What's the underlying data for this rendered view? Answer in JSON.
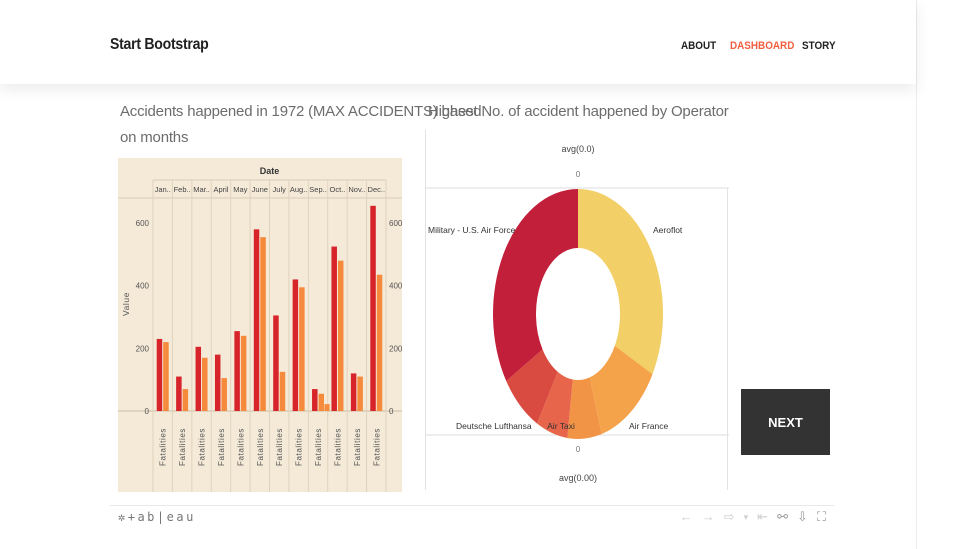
{
  "nav": {
    "brand": "Start Bootstrap",
    "links": [
      {
        "label": "ABOUT",
        "active": false
      },
      {
        "label": "DASHBOARD",
        "active": true
      },
      {
        "label": "STORY",
        "active": false
      }
    ],
    "accent": "#f05f40"
  },
  "bar_title_line1": "Accidents happened in 1972 (MAX ACCIDENTS) based",
  "bar_title_line2": "on months",
  "donut_title": "Highest No. of accident happened by Operator",
  "next_label": "NEXT",
  "tableau_logo": "+ab|eau",
  "tableau_tools": [
    "undo-icon",
    "redo-icon",
    "revert-icon",
    "dropdown-icon",
    "reset-icon",
    "share-icon",
    "download-icon",
    "fullscreen-icon"
  ],
  "chart_data": [
    {
      "type": "bar",
      "title": "",
      "header": "Date",
      "categories": [
        "Jan..",
        "Feb..",
        "Mar..",
        "April",
        "May",
        "June",
        "July",
        "Aug..",
        "Sep..",
        "Oct..",
        "Nov..",
        "Dec.."
      ],
      "category_sublabel": "Fatalities",
      "ylabel": "Value",
      "ylim": [
        0,
        680
      ],
      "yticks": [
        0,
        200,
        400,
        600
      ],
      "series": [
        {
          "color": "#d7242a",
          "values": [
            230,
            110,
            205,
            180,
            255,
            580,
            305,
            420,
            70,
            525,
            120,
            655
          ]
        },
        {
          "color": "#f58a3c",
          "values": [
            220,
            70,
            170,
            105,
            240,
            555,
            125,
            395,
            55,
            480,
            110,
            435
          ]
        }
      ],
      "extra_bar": {
        "category_index": 8,
        "color": "#f58a3c",
        "value": 22
      },
      "background": "#f5ead8"
    },
    {
      "type": "pie",
      "style": "donut",
      "top_label": "avg(0.0)",
      "top_value": "0",
      "bottom_value": "0",
      "bottom_label": "avg(0.00)",
      "slices": [
        {
          "label": "Aeroflot",
          "value": 33,
          "color": "#f2cf67"
        },
        {
          "label": "",
          "value": 12.5,
          "color": "#f5a34b"
        },
        {
          "label": "Air France",
          "value": 6.5,
          "color": "#f19446"
        },
        {
          "label": "Air Taxi",
          "value": 6,
          "color": "#e7654a"
        },
        {
          "label": "Deutsche Lufthansa",
          "value": 8,
          "color": "#d94b41"
        },
        {
          "label": "Military - U.S. Air Force",
          "value": 34,
          "color": "#c21f3a"
        }
      ]
    }
  ]
}
